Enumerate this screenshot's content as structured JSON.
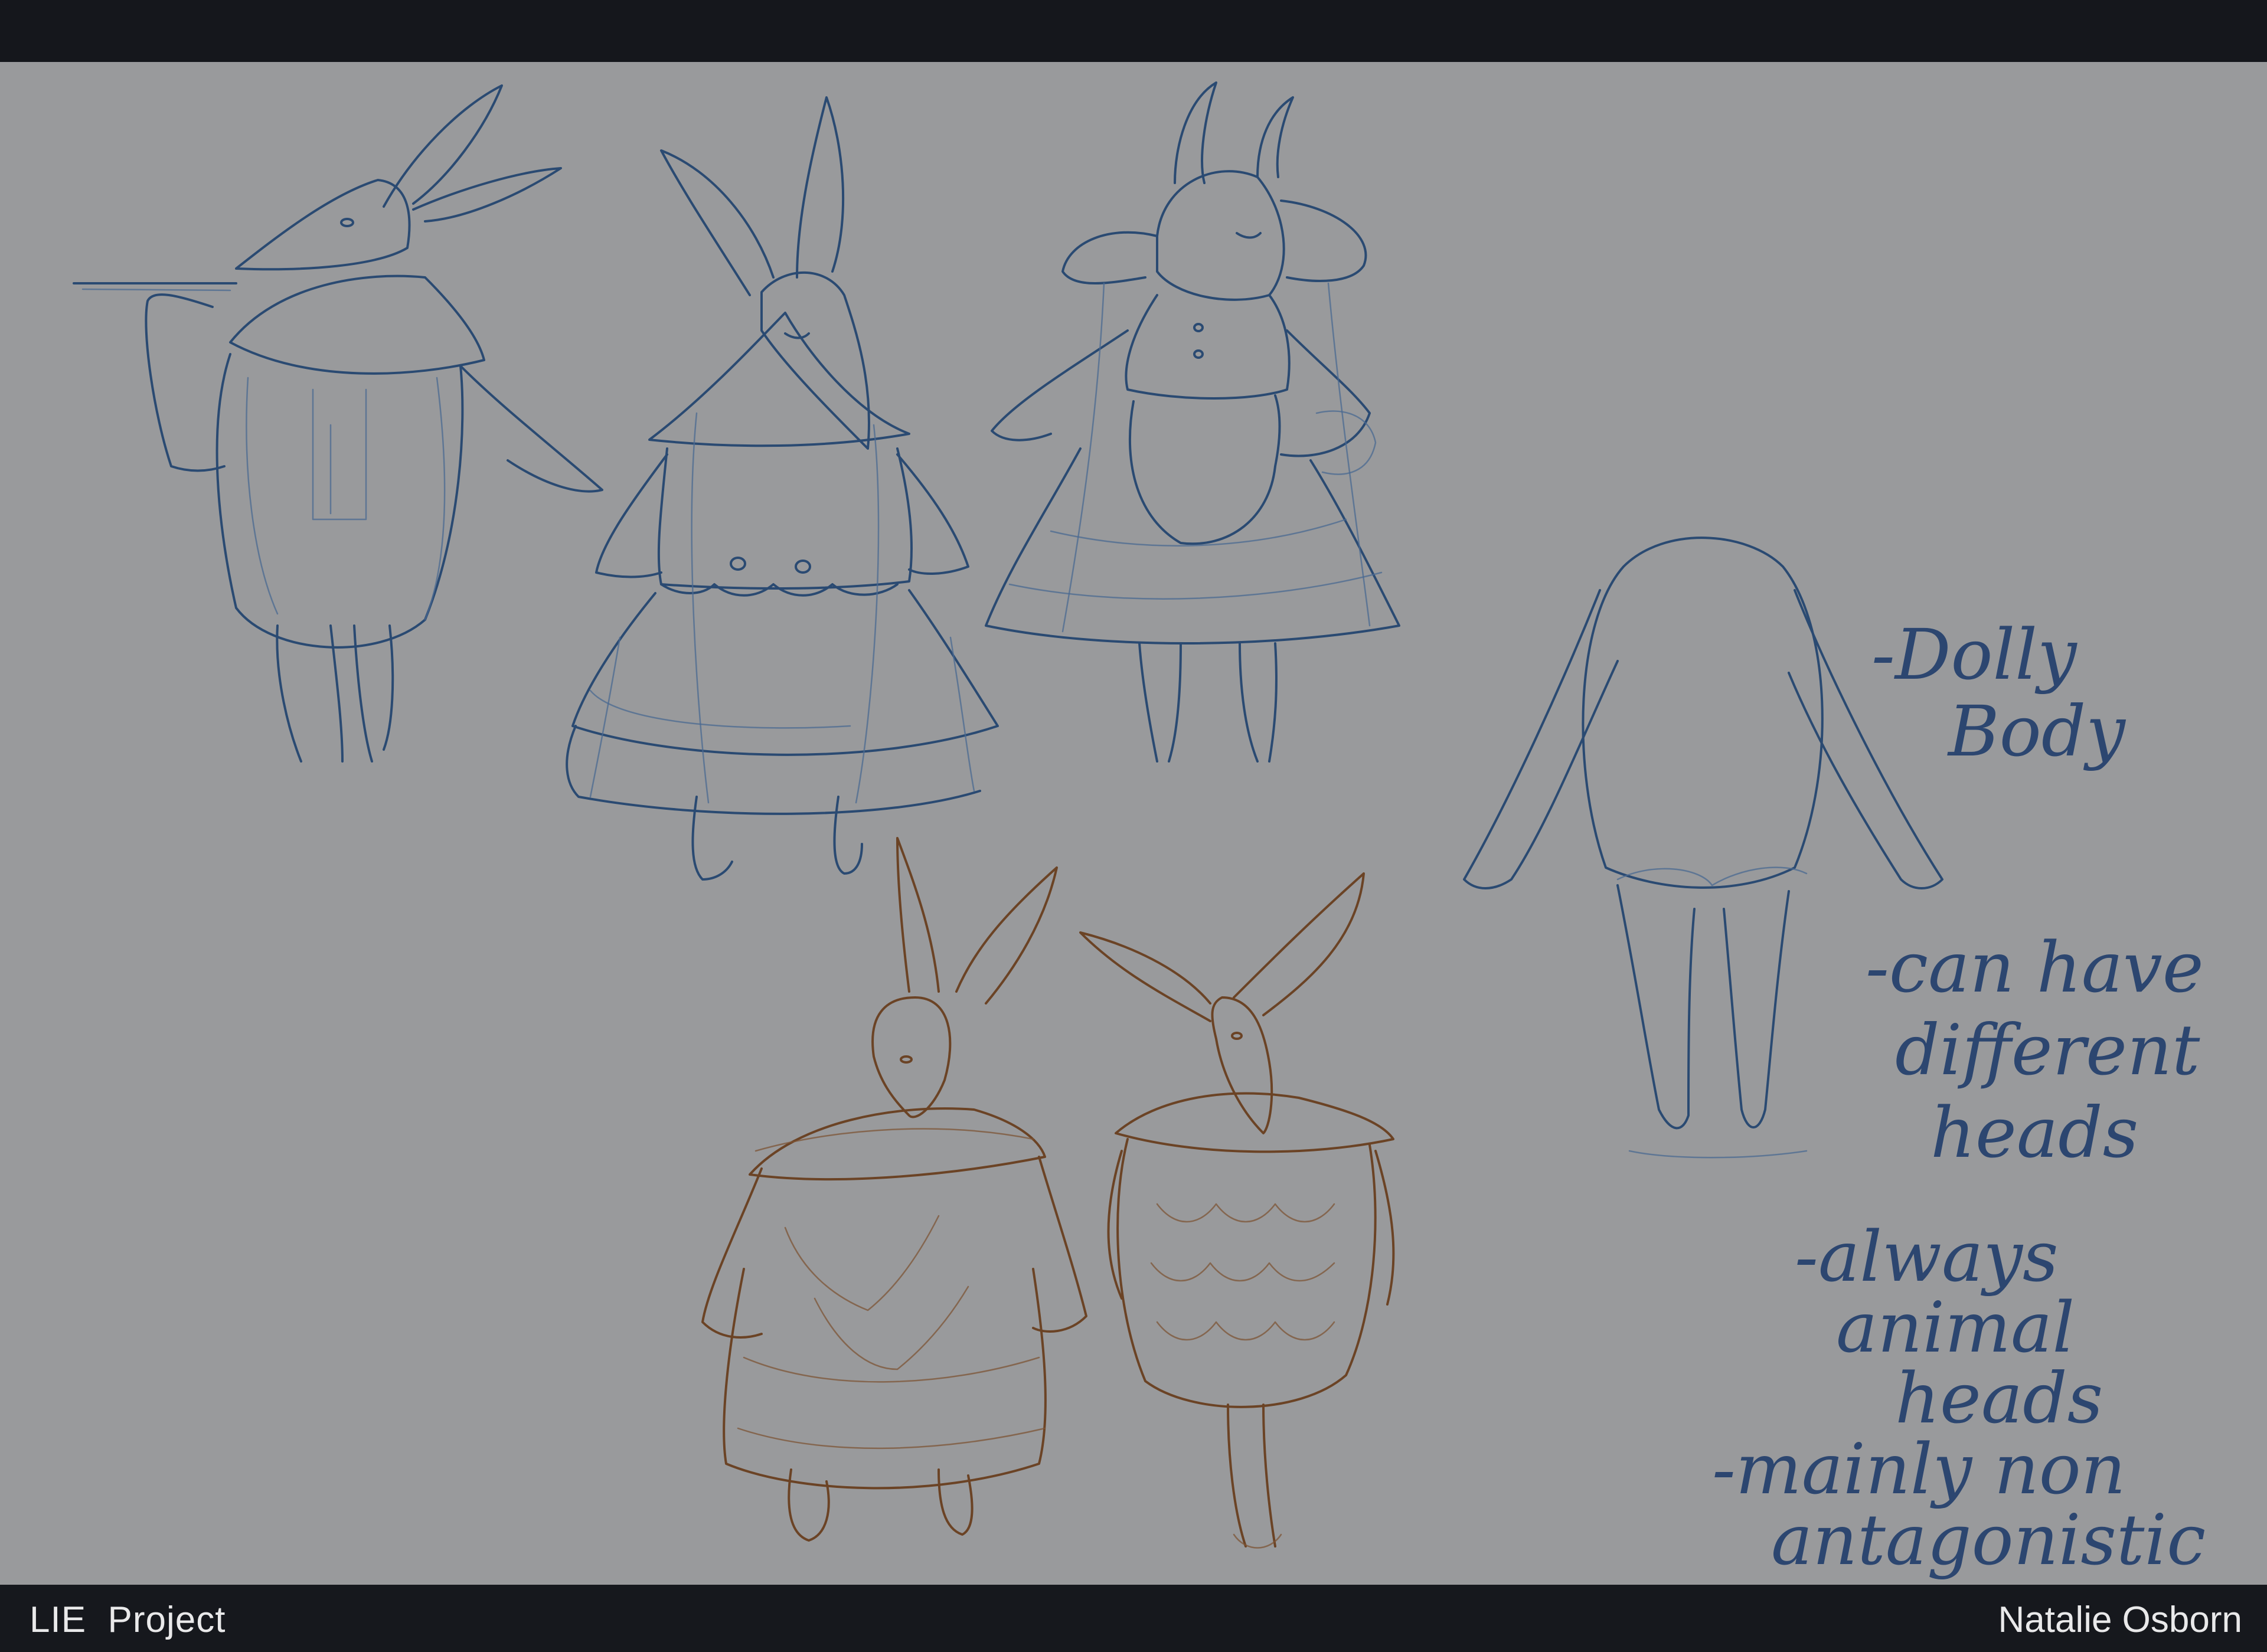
{
  "header": {},
  "artwork": {
    "notes": {
      "line1": "-Dolly",
      "line2": "Body",
      "line3": "-can have",
      "line4": "different",
      "line5": "heads",
      "line6": "-always",
      "line7": "animal",
      "line8": "heads",
      "line9": "-mainly non",
      "line10": "antagonistic"
    },
    "colors": {
      "background": "#999a9c",
      "blue_ink": "#2a4a72",
      "brown_ink": "#6b4325",
      "bar": "#15171c"
    }
  },
  "footer": {
    "project_title": "LIE  Project",
    "artist_name": "Natalie Osborn"
  }
}
